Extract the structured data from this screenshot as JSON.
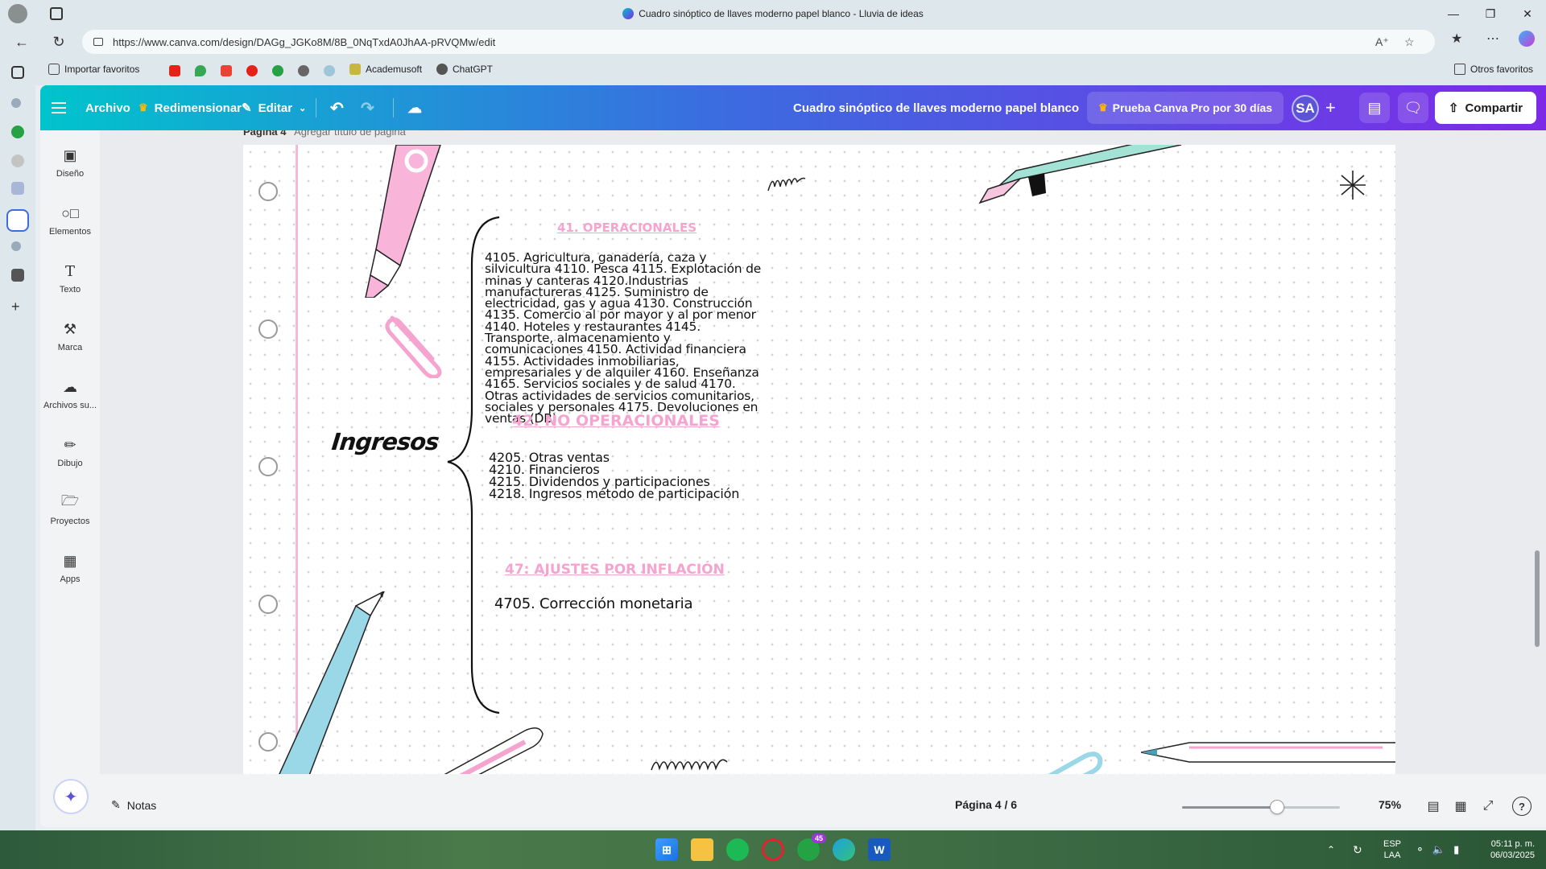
{
  "browser": {
    "window_title": "Cuadro sinóptico de llaves moderno papel blanco - Lluvia de ideas",
    "url": "https://www.canva.com/design/DAGg_JGKo8M/8B_0NqTxdA0JhAA-pRVQMw/edit",
    "bookmarks": [
      {
        "label": "Importar favoritos"
      },
      {
        "label": "Academusoft"
      },
      {
        "label": "ChatGPT"
      }
    ],
    "other_bookmarks": "Otros favoritos"
  },
  "canva": {
    "topbar": {
      "archivo": "Archivo",
      "redimensionar": "Redimensionar",
      "editar": "Editar",
      "doc_title": "Cuadro sinóptico de llaves moderno papel blanco",
      "pro_trial": "Prueba Canva Pro por 30 días",
      "avatar_initials": "SA",
      "share": "Compartir"
    },
    "leftnav": [
      {
        "label": "Diseño",
        "icon": "layout-icon"
      },
      {
        "label": "Elementos",
        "icon": "shapes-icon"
      },
      {
        "label": "Texto",
        "icon": "text-icon"
      },
      {
        "label": "Marca",
        "icon": "brand-icon"
      },
      {
        "label": "Archivos su...",
        "icon": "upload-cloud-icon"
      },
      {
        "label": "Dibujo",
        "icon": "draw-icon"
      },
      {
        "label": "Proyectos",
        "icon": "folder-icon"
      },
      {
        "label": "Apps",
        "icon": "apps-icon"
      }
    ],
    "page_label": {
      "number": "Página 4",
      "title_placeholder": "Agregar título de página"
    },
    "canvas": {
      "main_title": "Ingresos",
      "sections": [
        {
          "heading": "41. OPERACIONALES",
          "body": "4105. Agricultura, ganadería, caza y silvicultura 4110. Pesca 4115. Explotación de minas y canteras 4120.Industrias manufactureras 4125. Suministro de electricidad, gas y agua 4130. Construcción 4135. Comercio al por mayor y al por menor 4140. Hoteles y restaurantes 4145. Transporte, almacenamiento y comunicaciones 4150. Actividad financiera 4155. Actividades inmobiliarias, empresariales y de alquiler 4160. Enseñanza 4165. Servicios sociales y de salud 4170. Otras actividades de servicios comunitarios, sociales y personales 4175. Devoluciones en ventas (DB)"
        },
        {
          "heading": "42. NO OPERACIONALES",
          "lines": [
            "4205. Otras ventas",
            "4210. Financieros",
            "4215. Dividendos y participaciones",
            "4218. Ingresos método de participación"
          ]
        },
        {
          "heading": "47: AJUSTES POR INFLACIÓN",
          "lines": [
            "4705. Corrección monetaria"
          ]
        }
      ]
    },
    "bottombar": {
      "notes": "Notas",
      "page_indicator": "Página 4 / 6",
      "zoom": "75%",
      "zoom_level": 0.6
    }
  },
  "taskbar": {
    "lang": "ESP",
    "lang_sub": "LAA",
    "time": "05:11 p. m.",
    "date": "06/03/2025",
    "badge_count": "45"
  },
  "colors": {
    "accent_pink": "#f5a3cf",
    "canva_gradient_start": "#00c4cc",
    "canva_gradient_end": "#7d2ae8"
  }
}
